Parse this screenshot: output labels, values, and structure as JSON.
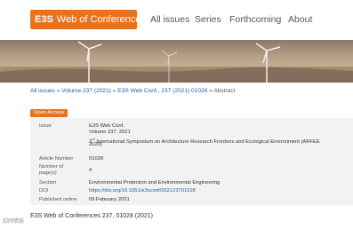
{
  "header": {
    "logo_e3s": "E3S",
    "logo_text": "Web of Conferences",
    "nav": [
      "All issues",
      "Series",
      "Forthcoming",
      "About"
    ]
  },
  "breadcrumb": {
    "items": [
      "All issues",
      "Volume 237 (2021)",
      "E3S Web Conf., 237 (2021) 01028"
    ],
    "current": "Abstract",
    "sep": "»"
  },
  "open_access": "Open Access",
  "meta": {
    "issue_label": "Issue",
    "issue_line1": "E3S Web Conf.",
    "issue_line2": "Volume 237, 2021",
    "issue_line3_pre": "3",
    "issue_line3_sup": "rd",
    "issue_line3_post": " International Symposium on Architecture Research Frontiers and Ecological Environment (ARFEE",
    "issue_line4": "2020)",
    "article_number_label": "Article Number",
    "article_number": "01028",
    "pages_label_1": "Number of",
    "pages_label_2": "page(s)",
    "pages": "4",
    "section_label": "Section",
    "section": "Environmental Protection and Environmental Engineering",
    "doi_label": "DOI",
    "doi": "https://doi.org/10.1051/e3sconf/202123701028",
    "published_label": "Published online",
    "published": "09 February 2021"
  },
  "bottom_title": "E3S Web of Conferences 237, 01028 (2021)",
  "watermark": "知网情报",
  "colors": {
    "accent": "#e8731f",
    "link": "#1f5ea8",
    "panel": "#f2f2f2"
  }
}
